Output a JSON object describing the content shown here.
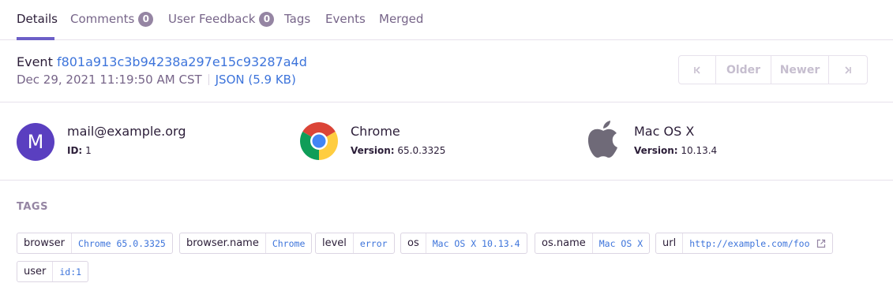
{
  "tabs": [
    {
      "label": "Details",
      "active": true
    },
    {
      "label": "Comments",
      "badge": "0"
    },
    {
      "label": "User Feedback",
      "badge": "0"
    },
    {
      "label": "Tags"
    },
    {
      "label": "Events"
    },
    {
      "label": "Merged"
    }
  ],
  "event": {
    "label": "Event",
    "id": "f801a913c3b94238a297e15c93287a4d",
    "datetime": "Dec 29, 2021 11:19:50 AM CST",
    "json_link": "JSON (5.9 KB)"
  },
  "pager": {
    "first_icon": "first-page-icon",
    "older": "Older",
    "newer": "Newer",
    "last_icon": "last-page-icon"
  },
  "user": {
    "avatar_letter": "M",
    "email": "mail@example.org",
    "id_label": "ID:",
    "id_value": "1",
    "avatar_color": "#5a3fc0"
  },
  "browser": {
    "name": "Chrome",
    "version_label": "Version:",
    "version_value": "65.0.3325",
    "icon": "chrome-icon"
  },
  "os": {
    "name": "Mac OS X",
    "version_label": "Version:",
    "version_value": "10.13.4",
    "icon": "apple-icon"
  },
  "tags": {
    "heading": "TAGS",
    "items": [
      {
        "key": "browser",
        "value": "Chrome 65.0.3325"
      },
      {
        "key": "browser.name",
        "value": "Chrome"
      },
      {
        "key": "level",
        "value": "error"
      },
      {
        "key": "os",
        "value": "Mac OS X 10.13.4"
      },
      {
        "key": "os.name",
        "value": "Mac OS X"
      },
      {
        "key": "url",
        "value": "http://example.com/foo",
        "external": true
      },
      {
        "key": "user",
        "value": "id:1"
      }
    ]
  },
  "colors": {
    "accent": "#6c5fc7",
    "link": "#3d74db",
    "muted": "#776589"
  }
}
